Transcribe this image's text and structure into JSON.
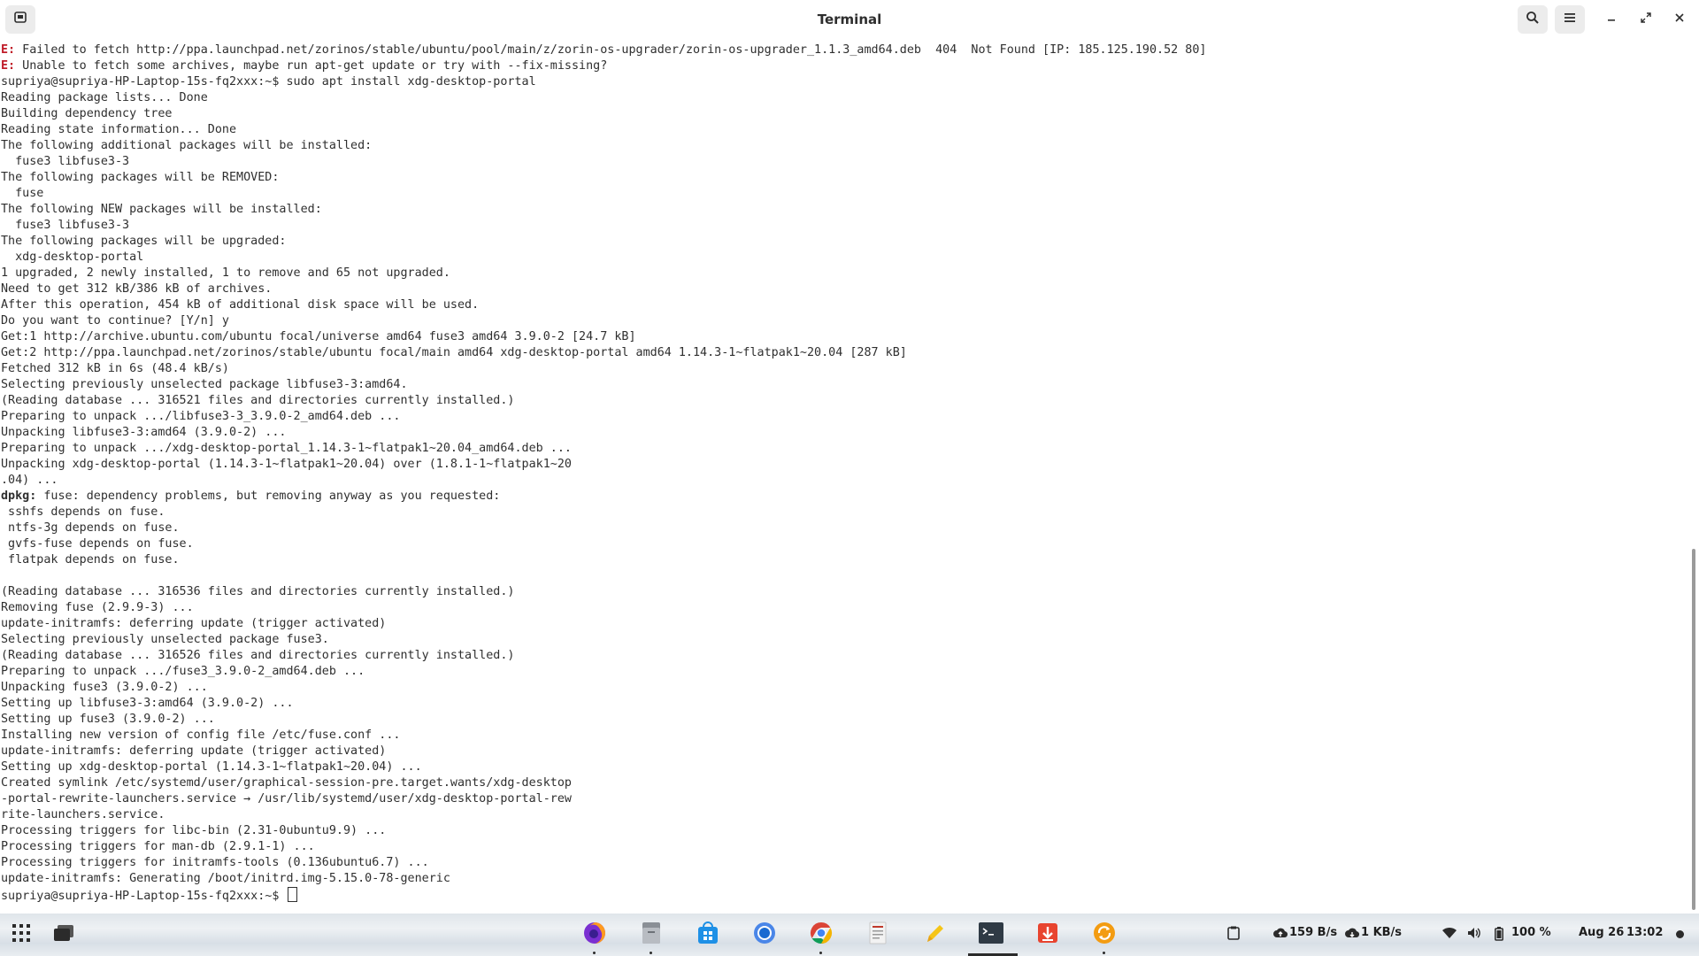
{
  "window": {
    "title": "Terminal",
    "icons": {
      "app": "terminal-app-icon",
      "search": "search-icon",
      "menu": "hamburger-menu-icon",
      "minimize": "minimize-icon",
      "restore": "restore-icon",
      "close": "close-icon"
    }
  },
  "terminal": {
    "lines": [
      {
        "prefix": "E:",
        "text": " Failed to fetch http://ppa.launchpad.net/zorinos/stable/ubuntu/pool/main/z/zorin-os-upgrader/zorin-os-upgrader_1.1.3_amd64.deb  404  Not Found [IP: 185.125.190.52 80]"
      },
      {
        "prefix": "E:",
        "text": " Unable to fetch some archives, maybe run apt-get update or try with --fix-missing?"
      },
      {
        "prefix": "",
        "text": "supriya@supriya-HP-Laptop-15s-fq2xxx:~$ sudo apt install xdg-desktop-portal"
      },
      {
        "prefix": "",
        "text": "Reading package lists... Done"
      },
      {
        "prefix": "",
        "text": "Building dependency tree"
      },
      {
        "prefix": "",
        "text": "Reading state information... Done"
      },
      {
        "prefix": "",
        "text": "The following additional packages will be installed:"
      },
      {
        "prefix": "",
        "text": "  fuse3 libfuse3-3"
      },
      {
        "prefix": "",
        "text": "The following packages will be REMOVED:"
      },
      {
        "prefix": "",
        "text": "  fuse"
      },
      {
        "prefix": "",
        "text": "The following NEW packages will be installed:"
      },
      {
        "prefix": "",
        "text": "  fuse3 libfuse3-3"
      },
      {
        "prefix": "",
        "text": "The following packages will be upgraded:"
      },
      {
        "prefix": "",
        "text": "  xdg-desktop-portal"
      },
      {
        "prefix": "",
        "text": "1 upgraded, 2 newly installed, 1 to remove and 65 not upgraded."
      },
      {
        "prefix": "",
        "text": "Need to get 312 kB/386 kB of archives."
      },
      {
        "prefix": "",
        "text": "After this operation, 454 kB of additional disk space will be used."
      },
      {
        "prefix": "",
        "text": "Do you want to continue? [Y/n] y"
      },
      {
        "prefix": "",
        "text": "Get:1 http://archive.ubuntu.com/ubuntu focal/universe amd64 fuse3 amd64 3.9.0-2 [24.7 kB]"
      },
      {
        "prefix": "",
        "text": "Get:2 http://ppa.launchpad.net/zorinos/stable/ubuntu focal/main amd64 xdg-desktop-portal amd64 1.14.3-1~flatpak1~20.04 [287 kB]"
      },
      {
        "prefix": "",
        "text": "Fetched 312 kB in 6s (48.4 kB/s)"
      },
      {
        "prefix": "",
        "text": "Selecting previously unselected package libfuse3-3:amd64."
      },
      {
        "prefix": "",
        "text": "(Reading database ... 316521 files and directories currently installed.)"
      },
      {
        "prefix": "",
        "text": "Preparing to unpack .../libfuse3-3_3.9.0-2_amd64.deb ..."
      },
      {
        "prefix": "",
        "text": "Unpacking libfuse3-3:amd64 (3.9.0-2) ..."
      },
      {
        "prefix": "",
        "text": "Preparing to unpack .../xdg-desktop-portal_1.14.3-1~flatpak1~20.04_amd64.deb ..."
      },
      {
        "prefix": "",
        "text": "Unpacking xdg-desktop-portal (1.14.3-1~flatpak1~20.04) over (1.8.1-1~flatpak1~20"
      },
      {
        "prefix": "",
        "text": ".04) ..."
      },
      {
        "prefix": "dpkg:",
        "text": " fuse: dependency problems, but removing anyway as you requested:"
      },
      {
        "prefix": "",
        "text": " sshfs depends on fuse."
      },
      {
        "prefix": "",
        "text": " ntfs-3g depends on fuse."
      },
      {
        "prefix": "",
        "text": " gvfs-fuse depends on fuse."
      },
      {
        "prefix": "",
        "text": " flatpak depends on fuse."
      },
      {
        "prefix": "",
        "text": ""
      },
      {
        "prefix": "",
        "text": "(Reading database ... 316536 files and directories currently installed.)"
      },
      {
        "prefix": "",
        "text": "Removing fuse (2.9.9-3) ..."
      },
      {
        "prefix": "",
        "text": "update-initramfs: deferring update (trigger activated)"
      },
      {
        "prefix": "",
        "text": "Selecting previously unselected package fuse3."
      },
      {
        "prefix": "",
        "text": "(Reading database ... 316526 files and directories currently installed.)"
      },
      {
        "prefix": "",
        "text": "Preparing to unpack .../fuse3_3.9.0-2_amd64.deb ..."
      },
      {
        "prefix": "",
        "text": "Unpacking fuse3 (3.9.0-2) ..."
      },
      {
        "prefix": "",
        "text": "Setting up libfuse3-3:amd64 (3.9.0-2) ..."
      },
      {
        "prefix": "",
        "text": "Setting up fuse3 (3.9.0-2) ..."
      },
      {
        "prefix": "",
        "text": "Installing new version of config file /etc/fuse.conf ..."
      },
      {
        "prefix": "",
        "text": "update-initramfs: deferring update (trigger activated)"
      },
      {
        "prefix": "",
        "text": "Setting up xdg-desktop-portal (1.14.3-1~flatpak1~20.04) ..."
      },
      {
        "prefix": "",
        "text": "Created symlink /etc/systemd/user/graphical-session-pre.target.wants/xdg-desktop"
      },
      {
        "prefix": "",
        "text": "-portal-rewrite-launchers.service → /usr/lib/systemd/user/xdg-desktop-portal-rew"
      },
      {
        "prefix": "",
        "text": "rite-launchers.service."
      },
      {
        "prefix": "",
        "text": "Processing triggers for libc-bin (2.31-0ubuntu9.9) ..."
      },
      {
        "prefix": "",
        "text": "Processing triggers for man-db (2.9.1-1) ..."
      },
      {
        "prefix": "",
        "text": "Processing triggers for initramfs-tools (0.136ubuntu6.7) ..."
      },
      {
        "prefix": "",
        "text": "update-initramfs: Generating /boot/initrd.img-5.15.0-78-generic"
      }
    ],
    "prompt": "supriya@supriya-HP-Laptop-15s-fq2xxx:~$ "
  },
  "taskbar": {
    "apps": [
      {
        "name": "firefox-icon",
        "running": true,
        "active": false
      },
      {
        "name": "files-icon",
        "running": true,
        "active": false
      },
      {
        "name": "software-store-icon",
        "running": false,
        "active": false
      },
      {
        "name": "chromium-icon",
        "running": false,
        "active": false
      },
      {
        "name": "chrome-icon",
        "running": true,
        "active": false
      },
      {
        "name": "document-viewer-icon",
        "running": false,
        "active": false
      },
      {
        "name": "text-editor-icon",
        "running": false,
        "active": false
      },
      {
        "name": "terminal-icon",
        "running": true,
        "active": true
      },
      {
        "name": "downloader-icon",
        "running": false,
        "active": false
      },
      {
        "name": "update-icon",
        "running": true,
        "active": false
      }
    ],
    "tray": {
      "upload_speed": "159 B/s",
      "download_speed": "1 KB/s",
      "battery": "100 %",
      "date": "Aug 26",
      "time": "13:02"
    }
  }
}
